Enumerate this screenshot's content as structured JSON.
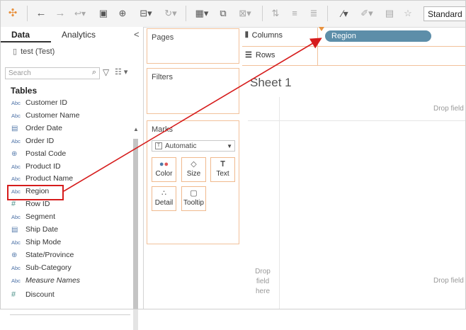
{
  "toolbar": {
    "icons": [
      "tableau-logo-icon",
      "back-icon",
      "forward-icon",
      "redo-icon",
      "save-icon",
      "new-datasource-icon",
      "datasource-icon",
      "refresh-icon",
      "new-sheet-icon",
      "duplicate-icon",
      "clear-icon",
      "swap-icon",
      "sort-asc-icon",
      "sort-desc-icon",
      "highlight-icon",
      "annotate-icon",
      "labels-icon",
      "pin-icon"
    ],
    "view_size": "Standard"
  },
  "data_pane": {
    "tab_data": "Data",
    "tab_analytics": "Analytics",
    "collapse": "<",
    "datasource": "test (Test)",
    "search_placeholder": "Search",
    "tables_header": "Tables",
    "fields": [
      {
        "type": "Abc",
        "name": "Customer ID",
        "icon": "string-icon"
      },
      {
        "type": "Abc",
        "name": "Customer Name",
        "icon": "string-icon"
      },
      {
        "type": "date",
        "name": "Order Date",
        "icon": "date-icon"
      },
      {
        "type": "Abc",
        "name": "Order ID",
        "icon": "string-icon"
      },
      {
        "type": "geo",
        "name": "Postal Code",
        "icon": "globe-icon"
      },
      {
        "type": "Abc",
        "name": "Product ID",
        "icon": "string-icon"
      },
      {
        "type": "Abc",
        "name": "Product Name",
        "icon": "string-icon"
      },
      {
        "type": "Abc",
        "name": "Region",
        "icon": "string-icon"
      },
      {
        "type": "#",
        "name": "Row ID",
        "icon": "number-icon"
      },
      {
        "type": "Abc",
        "name": "Segment",
        "icon": "string-icon"
      },
      {
        "type": "date",
        "name": "Ship Date",
        "icon": "date-icon"
      },
      {
        "type": "Abc",
        "name": "Ship Mode",
        "icon": "string-icon"
      },
      {
        "type": "geo",
        "name": "State/Province",
        "icon": "globe-icon"
      },
      {
        "type": "Abc",
        "name": "Sub-Category",
        "icon": "string-icon"
      },
      {
        "type": "Abc",
        "name": "Measure Names",
        "icon": "string-icon",
        "italic": true
      },
      {
        "type": "#",
        "name": "Discount",
        "icon": "number-icon"
      }
    ]
  },
  "shelves": {
    "pages": "Pages",
    "filters": "Filters",
    "marks": "Marks",
    "mark_type": "Automatic",
    "mark_buttons": [
      "Color",
      "Size",
      "Text",
      "Detail",
      "Tooltip"
    ],
    "columns": "Columns",
    "rows": "Rows",
    "columns_pill": "Region"
  },
  "sheet": {
    "title": "Sheet 1",
    "drop_field_top": "Drop field",
    "drop_field_bottom": "Drop field",
    "drop_field_here": "Drop field here"
  },
  "colors": {
    "pill": "#5d8ea9",
    "shelf_border": "#f2c19a",
    "annotation_red": "#d61c1c"
  }
}
